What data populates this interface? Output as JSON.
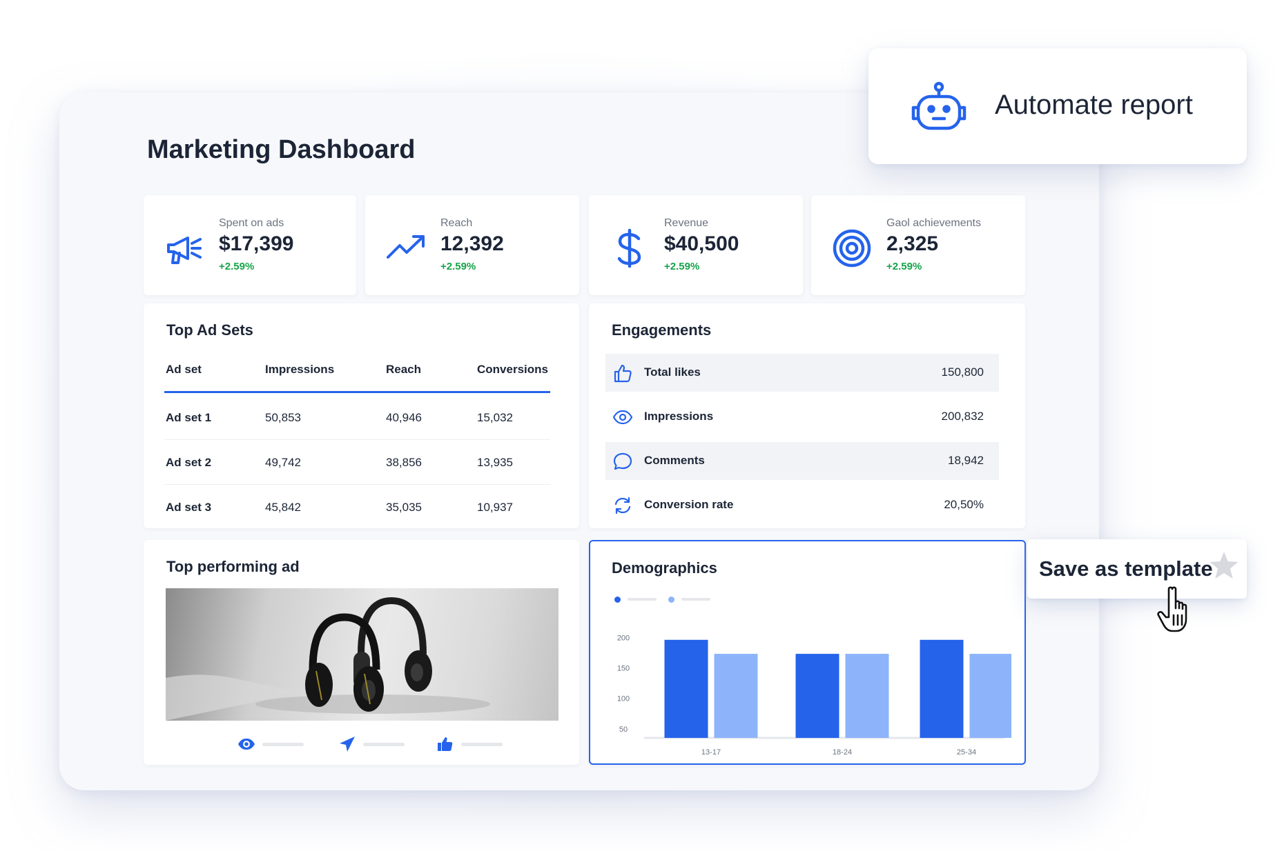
{
  "page_title": "Marketing Dashboard",
  "kpis": [
    {
      "label": "Spent on ads",
      "value": "$17,399",
      "change": "+2.59%",
      "icon": "megaphone-icon"
    },
    {
      "label": "Reach",
      "value": "12,392",
      "change": "+2.59%",
      "icon": "trending-up-icon"
    },
    {
      "label": "Revenue",
      "value": "$40,500",
      "change": "+2.59%",
      "icon": "dollar-icon"
    },
    {
      "label": "Gaol achievements",
      "value": "2,325",
      "change": "+2.59%",
      "icon": "target-icon"
    }
  ],
  "top_ad_sets": {
    "title": "Top Ad Sets",
    "columns": [
      "Ad set",
      "Impressions",
      "Reach",
      "Conversions"
    ],
    "rows": [
      [
        "Ad set 1",
        "50,853",
        "40,946",
        "15,032"
      ],
      [
        "Ad set 2",
        "49,742",
        "38,856",
        "13,935"
      ],
      [
        "Ad set 3",
        "45,842",
        "35,035",
        "10,937"
      ]
    ]
  },
  "engagements": {
    "title": "Engagements",
    "items": [
      {
        "label": "Total likes",
        "value": "150,800",
        "icon": "thumbs-up-icon"
      },
      {
        "label": "Impressions",
        "value": "200,832",
        "icon": "eye-icon"
      },
      {
        "label": "Comments",
        "value": "18,942",
        "icon": "comment-icon"
      },
      {
        "label": "Conversion rate",
        "value": "20,50%",
        "icon": "refresh-icon"
      }
    ]
  },
  "top_ad": {
    "title": "Top performing ad",
    "stats_icons": [
      "eye-icon",
      "send-icon",
      "like-icon"
    ]
  },
  "demographics": {
    "title": "Demographics"
  },
  "chart_data": {
    "type": "bar",
    "categories": [
      "13-17",
      "18-24",
      "25-34"
    ],
    "series": [
      {
        "values": [
          196,
          173,
          196
        ]
      },
      {
        "values": [
          173,
          173,
          173
        ]
      }
    ],
    "y_ticks": [
      "200",
      "150",
      "100",
      "50"
    ],
    "ylim": [
      35,
      215
    ],
    "grid": false,
    "legend": "top-left",
    "colors": [
      "#2563eb",
      "#8db4fb"
    ]
  },
  "automate": {
    "label": "Automate report"
  },
  "save_template": {
    "label": "Save as template"
  },
  "colors": {
    "accent": "#2563eb",
    "accent_light": "#8db4fb",
    "positive": "#16a34a",
    "text": "#1c2536"
  }
}
